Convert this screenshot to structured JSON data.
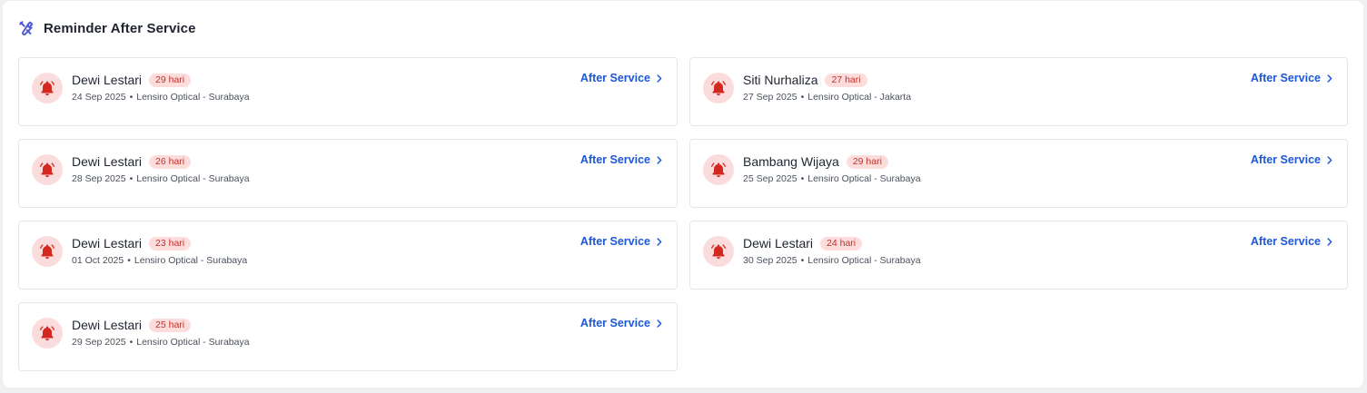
{
  "header": {
    "title": "Reminder After Service",
    "icon": "tools-icon",
    "icon_color": "#4f5bd5"
  },
  "colors": {
    "accent_link": "#1d57d8",
    "badge_bg": "#fddcdc",
    "badge_text": "#c0322b",
    "bell_bg": "#fbdcdc",
    "bell_fg": "#d3281f"
  },
  "reminders": [
    {
      "name": "Dewi Lestari",
      "badge": "29 hari",
      "date": "24 Sep 2025",
      "separator": "•",
      "location": "Lensiro Optical - Surabaya",
      "action": "After Service",
      "icon": "bell-icon"
    },
    {
      "name": "Siti Nurhaliza",
      "badge": "27 hari",
      "date": "27 Sep 2025",
      "separator": "•",
      "location": "Lensiro Optical - Jakarta",
      "action": "After Service",
      "icon": "bell-icon"
    },
    {
      "name": "Dewi Lestari",
      "badge": "26 hari",
      "date": "28 Sep 2025",
      "separator": "•",
      "location": "Lensiro Optical - Surabaya",
      "action": "After Service",
      "icon": "bell-icon"
    },
    {
      "name": "Bambang Wijaya",
      "badge": "29 hari",
      "date": "25 Sep 2025",
      "separator": "•",
      "location": "Lensiro Optical - Surabaya",
      "action": "After Service",
      "icon": "bell-icon"
    },
    {
      "name": "Dewi Lestari",
      "badge": "23 hari",
      "date": "01 Oct 2025",
      "separator": "•",
      "location": "Lensiro Optical - Surabaya",
      "action": "After Service",
      "icon": "bell-icon"
    },
    {
      "name": "Dewi Lestari",
      "badge": "24 hari",
      "date": "30 Sep 2025",
      "separator": "•",
      "location": "Lensiro Optical - Surabaya",
      "action": "After Service",
      "icon": "bell-icon"
    },
    {
      "name": "Dewi Lestari",
      "badge": "25 hari",
      "date": "29 Sep 2025",
      "separator": "•",
      "location": "Lensiro Optical - Surabaya",
      "action": "After Service",
      "icon": "bell-icon"
    }
  ]
}
